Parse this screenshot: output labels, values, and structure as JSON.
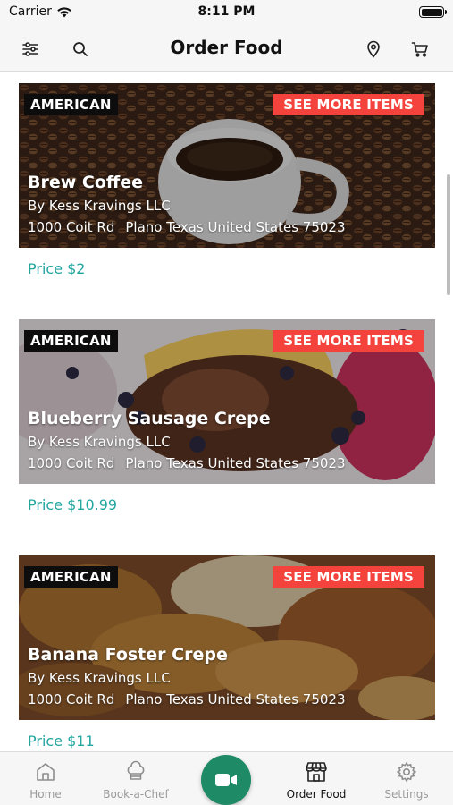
{
  "status_bar": {
    "carrier": "Carrier",
    "time": "8:11 PM",
    "battery_level": 1.0
  },
  "header": {
    "title": "Order Food",
    "left_icons": [
      "filter-sliders-icon",
      "search-icon"
    ],
    "right_icons": [
      "location-pin-icon",
      "cart-icon"
    ]
  },
  "items": [
    {
      "cuisine": "AMERICAN",
      "more_label": "SEE MORE ITEMS",
      "name": "Brew Coffee",
      "vendor": "By Kess Kravings LLC",
      "street": "1000 Coit Rd",
      "city_line": "Plano Texas United States 75023",
      "price": "Price $2"
    },
    {
      "cuisine": "AMERICAN",
      "more_label": "SEE MORE ITEMS",
      "name": "Blueberry Sausage Crepe",
      "vendor": "By Kess Kravings LLC",
      "street": "1000 Coit Rd",
      "city_line": "Plano Texas United States 75023",
      "price": "Price $10.99"
    },
    {
      "cuisine": "AMERICAN",
      "more_label": "SEE MORE ITEMS",
      "name": "Banana Foster Crepe",
      "vendor": "By Kess Kravings LLC",
      "street": "1000 Coit Rd",
      "city_line": "Plano Texas United States 75023",
      "price": "Price $11"
    }
  ],
  "tab_bar": {
    "tabs": [
      {
        "label": "Home",
        "icon": "home-icon",
        "active": false
      },
      {
        "label": "Book-a-Chef",
        "icon": "chef-hat-icon",
        "active": false
      },
      {
        "label": "Order Food",
        "icon": "storefront-icon",
        "active": true
      },
      {
        "label": "Settings",
        "icon": "gear-icon",
        "active": false
      }
    ],
    "center_button_icon": "video-camera-icon"
  },
  "colors": {
    "accent_red": "#f4433c",
    "price_teal": "#23a6a0",
    "camera_green": "#1e8a66",
    "badge_black": "#0d0d0d"
  }
}
